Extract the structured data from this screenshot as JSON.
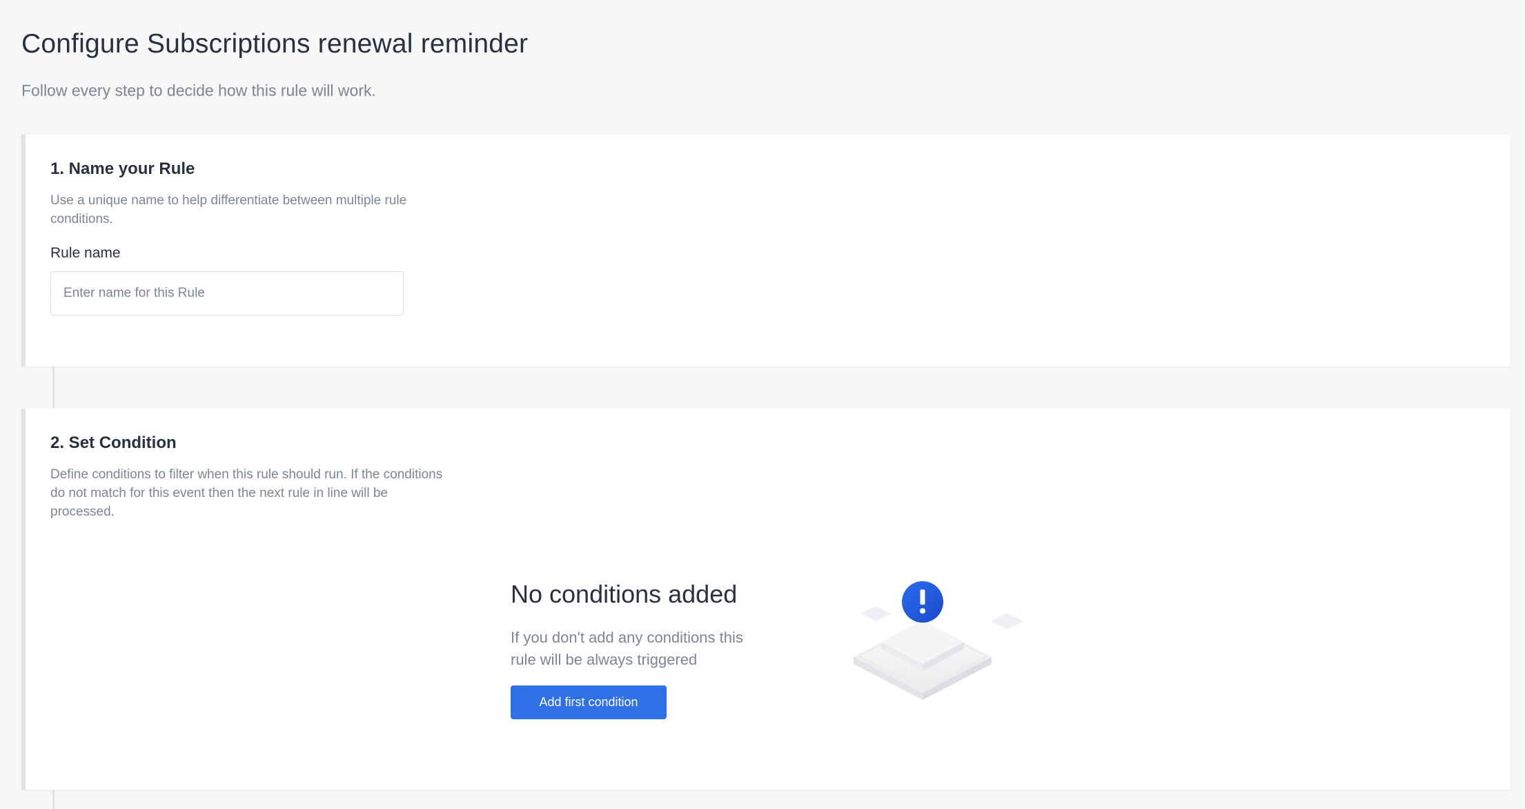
{
  "header": {
    "title": "Configure Subscriptions renewal reminder",
    "subtitle": "Follow every step to decide how this rule will work."
  },
  "steps": [
    {
      "title": "1. Name your Rule",
      "description": "Use a unique name to help differentiate between multiple rule conditions.",
      "field_label": "Rule name",
      "input_value": "",
      "input_placeholder": "Enter name for this Rule"
    },
    {
      "title": "2. Set Condition",
      "description": "Define conditions to filter when this rule should run. If the conditions do not match for this event then the next rule in line will be processed.",
      "empty_state": {
        "title": "No conditions added",
        "description": "If you don't add any conditions this rule will be always triggered",
        "button_label": "Add first condition",
        "icon": "exclamation-icon"
      }
    }
  ],
  "colors": {
    "accent": "#2f6fe8",
    "text_primary": "#283140",
    "text_secondary": "#7c8594",
    "border": "#dfe3e8",
    "background": "#f7f7f8"
  }
}
